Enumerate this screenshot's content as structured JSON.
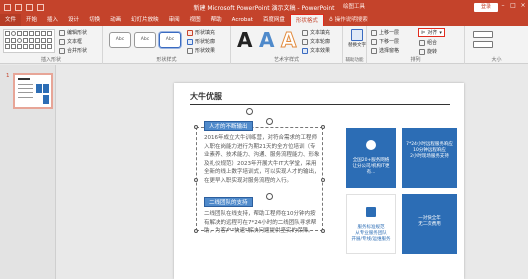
{
  "window": {
    "title": "新建 Microsoft PowerPoint 演示文稿 - PowerPoint",
    "contextual_label": "绘图工具",
    "login": "登录"
  },
  "tabs": [
    "文件",
    "开始",
    "插入",
    "设计",
    "切换",
    "动画",
    "幻灯片放映",
    "审阅",
    "视图",
    "帮助",
    "Acrobat",
    "百度网盘",
    "形状格式",
    "操作说明搜索"
  ],
  "ribbon": {
    "groups": {
      "insert_shapes": "插入形状",
      "shape_styles": "形状样式",
      "wordart_styles": "艺术字样式",
      "accessibility": "辅助功能",
      "arrange": "排列",
      "size": "大小"
    },
    "edit_shape": "编辑形状",
    "text_box": "文本框",
    "merge_shapes": "合并形状",
    "style_preset": "Abc",
    "shape_fill": "形状填充",
    "shape_outline": "形状轮廓",
    "shape_effects": "形状效果",
    "text_fill": "文本填充",
    "text_outline": "文本轮廓",
    "text_effects": "文本效果",
    "alt_text": "替换文字",
    "bring_forward": "上移一层",
    "send_backward": "下移一层",
    "selection_pane": "选择窗格",
    "align": "对齐",
    "group": "组合",
    "rotate": "旋转"
  },
  "slide_panel": {
    "slide_number": "1"
  },
  "slide": {
    "title": "大牛优服",
    "label1": "人才的不断输出",
    "para1": "2016年成立大牛训练营，对符合需求的工程师入职在岗能力进行为期21天的全方位培训（专业素养、技术能力、沟通、服务流程能力、形象及礼仪规范）2023年开展大牛IT大学堂，采用全新的线上数字培训式，可以实现人才的输出，在更早入职实现对服务流程的入行。",
    "label2": "二线团队的支持",
    "para2": "二线团队在线支持，帮助工程师在10分钟内按有解决的远程可在7*24小时的二线团队寻求帮助，为客户\"快速\"解决问题提供坚实的保障。",
    "cards": [
      "全国20+服务网络\n让分公司/机构IT更有...",
      "7*24小时远程服务响应\n10分钟远程响应\n2小时现场服务支持",
      "服务标准规范\n从专业服务团队\n开展/专线/运维服务",
      "一对快全年\n无二次费用"
    ]
  },
  "colors": {
    "brand_red": "#c4432b",
    "slide_blue": "#2c6db5",
    "label_blue": "#4f8acb"
  }
}
